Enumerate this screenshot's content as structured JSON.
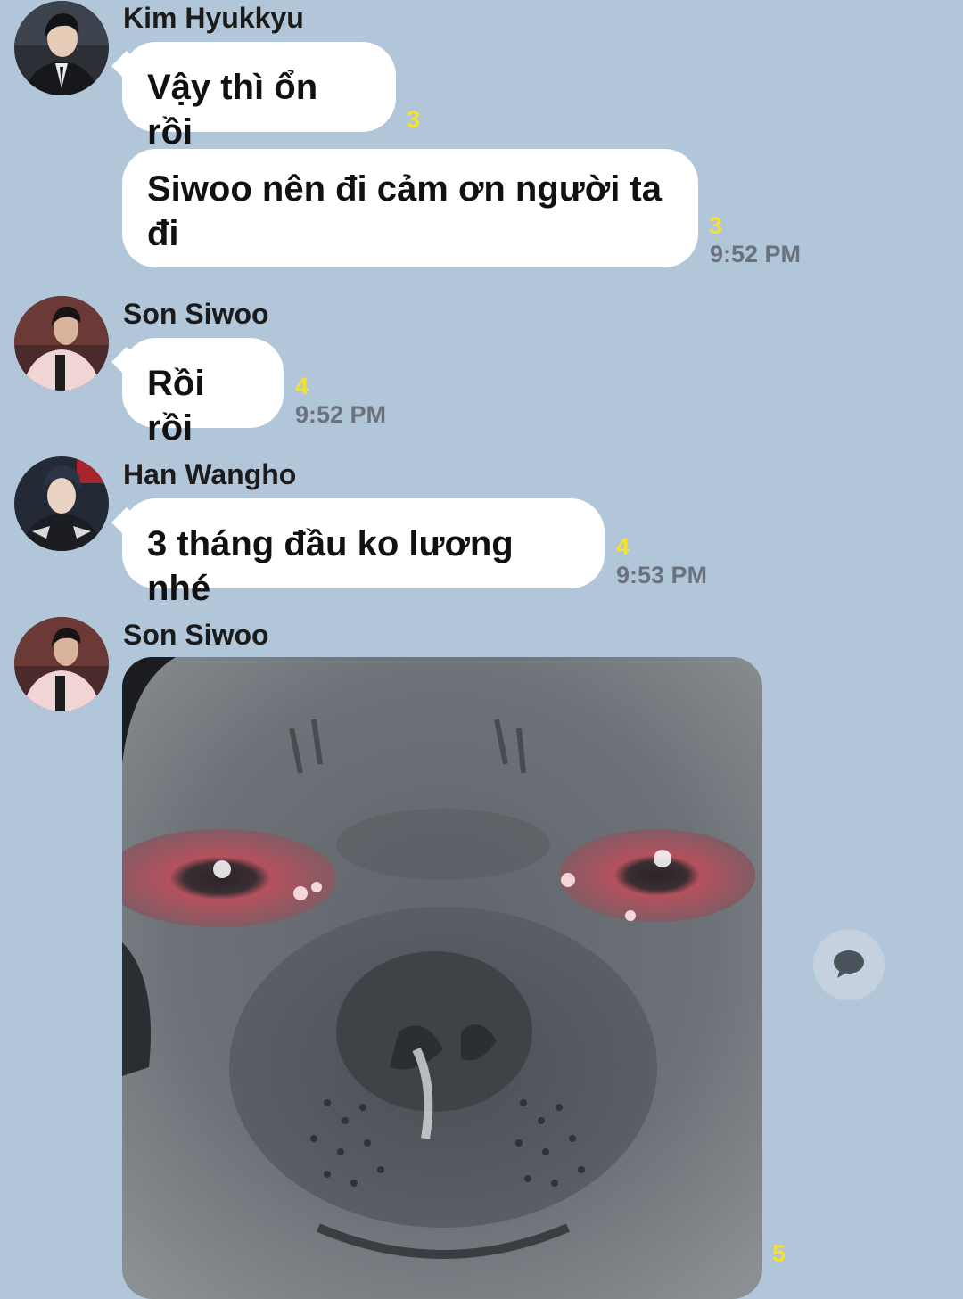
{
  "messages": [
    {
      "sender": "Kim Hyukkyu",
      "bubbles": [
        {
          "text": "Vậy thì ổn rồi",
          "unread": "3"
        },
        {
          "text": "Siwoo nên đi cảm ơn người ta đi",
          "unread": "3",
          "time": "9:52 PM"
        }
      ]
    },
    {
      "sender": "Son Siwoo",
      "bubbles": [
        {
          "text": "Rồi rồi",
          "unread": "4",
          "time": "9:52 PM"
        }
      ]
    },
    {
      "sender": "Han Wangho",
      "bubbles": [
        {
          "text": "3 tháng đầu ko lương nhé",
          "unread": "4",
          "time": "9:53 PM"
        }
      ]
    },
    {
      "sender": "Son Siwoo",
      "image": {
        "icon": "crying-seal-image",
        "unread": "5"
      }
    }
  ],
  "icons": {
    "avatar": "profile-photo-icon",
    "comment": "speech-bubble-icon"
  },
  "colors": {
    "background": "#b2c6da",
    "bubble": "#ffffff",
    "unread": "#f5e230",
    "time": "#6a737d"
  }
}
